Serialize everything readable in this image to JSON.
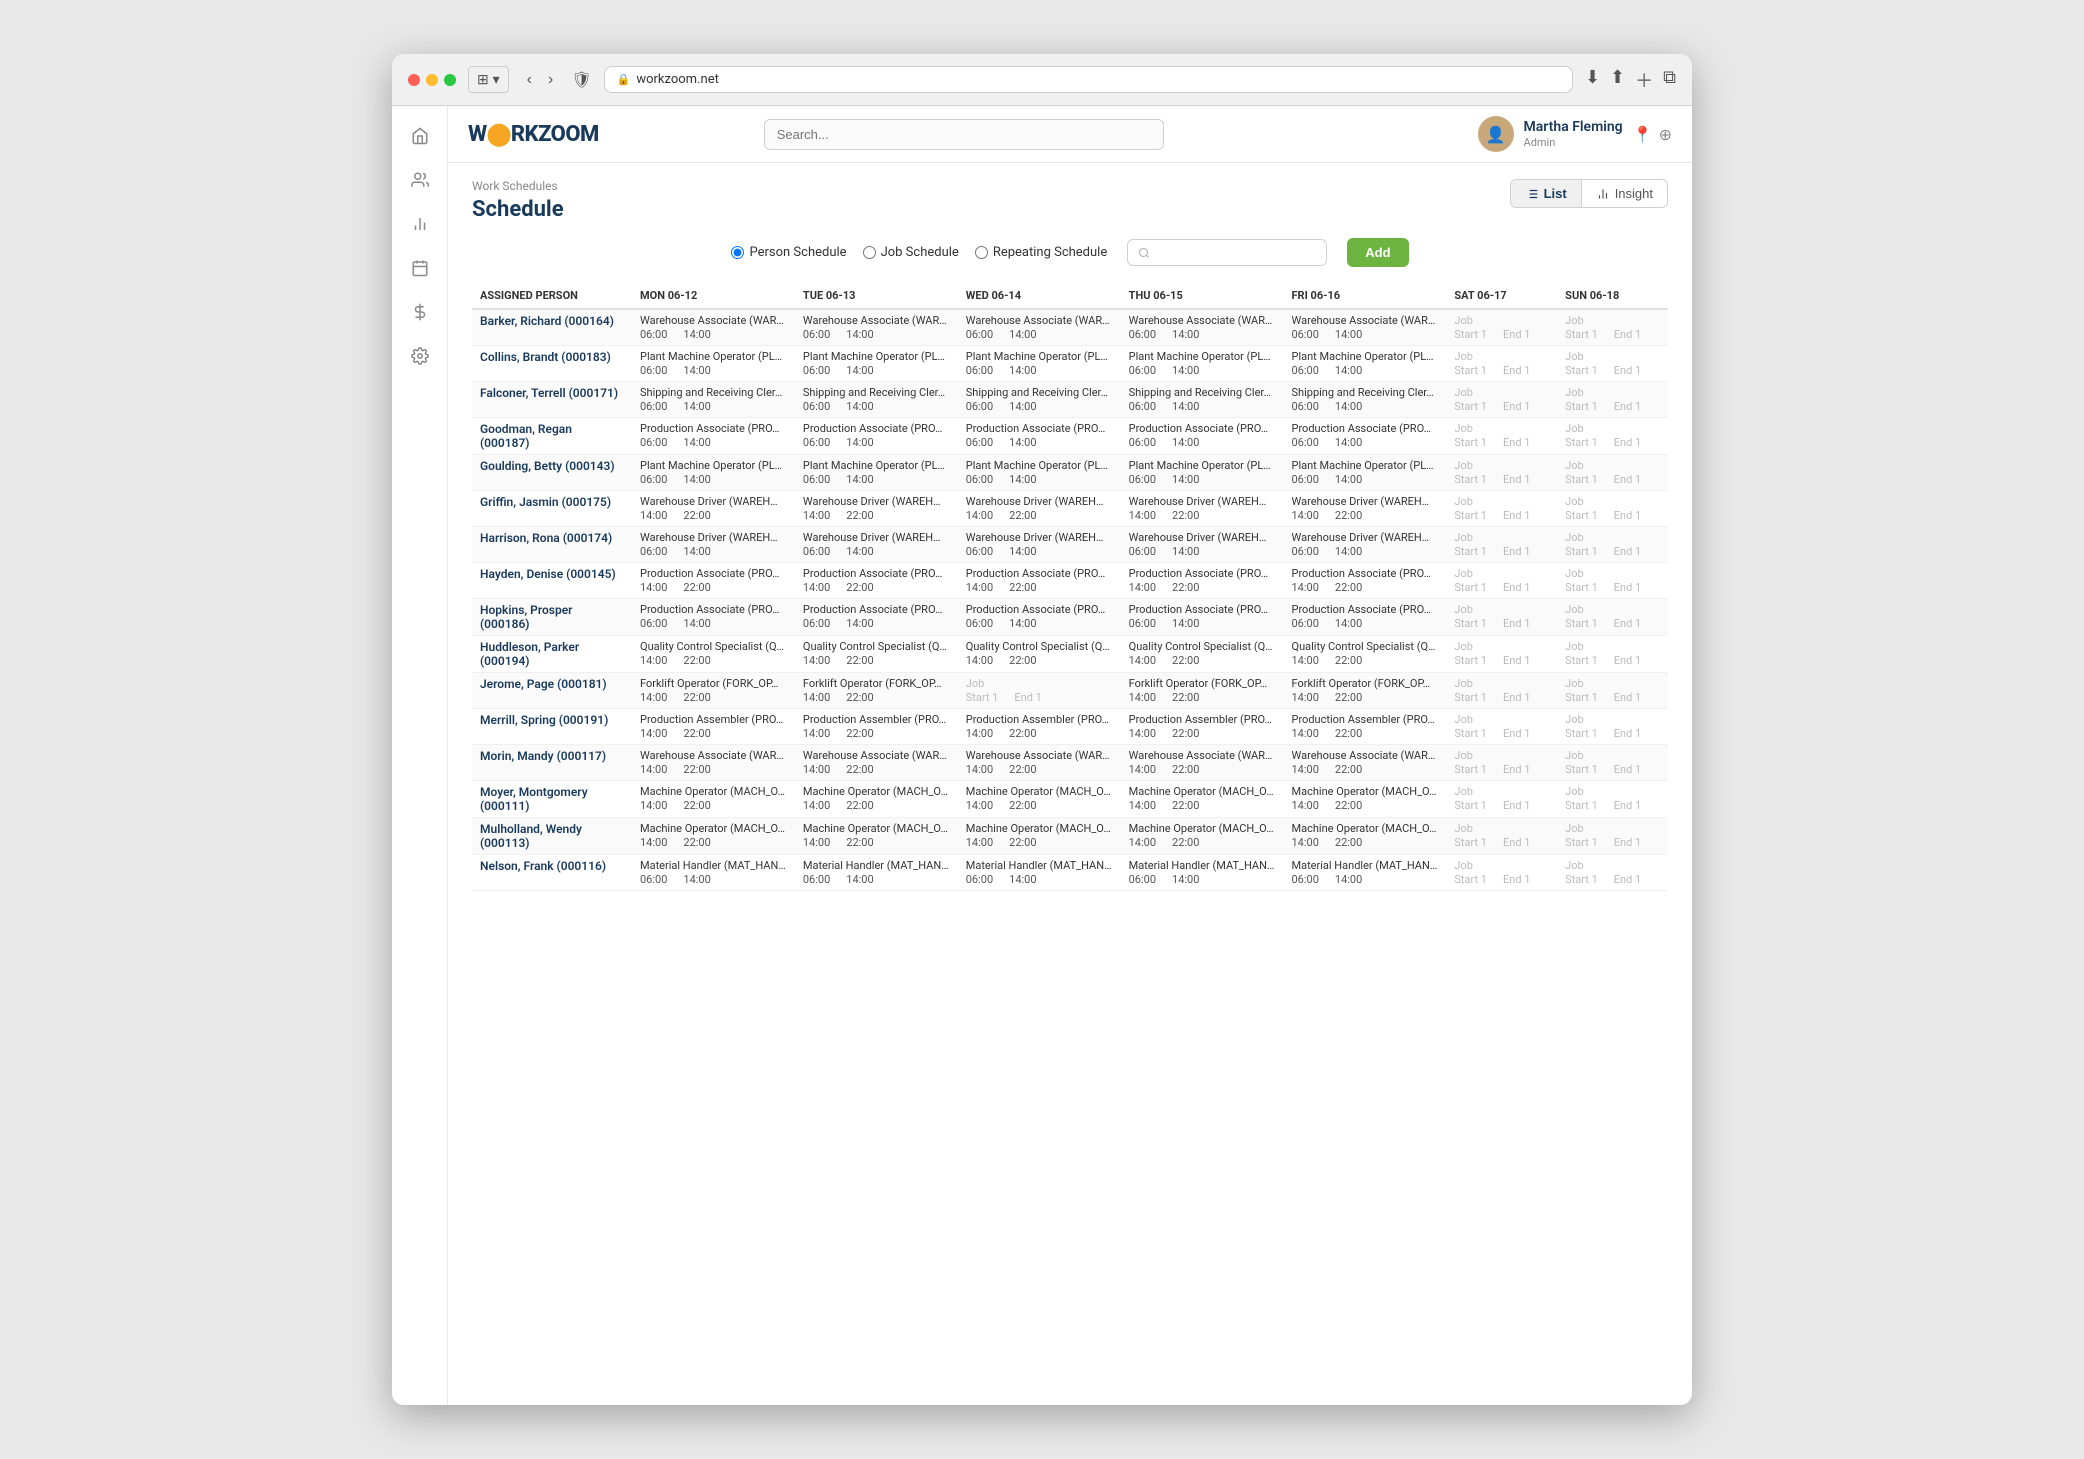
{
  "browser": {
    "url": "workzoom.net"
  },
  "header": {
    "logo": "WORKZOOM",
    "search_placeholder": "Search...",
    "user": {
      "name": "Martha Fleming",
      "role": "Admin"
    }
  },
  "breadcrumb": "Work Schedules",
  "page_title": "Schedule",
  "view_toggle": {
    "list_label": "List",
    "insight_label": "Insight"
  },
  "filters": {
    "person_schedule": "Person Schedule",
    "job_schedule": "Job Schedule",
    "repeating_schedule": "Repeating Schedule",
    "search_placeholder": "",
    "add_label": "Add"
  },
  "columns": [
    "ASSIGNED PERSON",
    "MON 06-12",
    "TUE 06-13",
    "WED 06-14",
    "THU 06-15",
    "FRI 06-16",
    "SAT 06-17",
    "SUN 06-18"
  ],
  "rows": [
    {
      "person": "Barker, Richard (000164)",
      "days": [
        {
          "job": "Warehouse Associate (WAR…",
          "start": "06:00",
          "end": "14:00"
        },
        {
          "job": "Warehouse Associate (WAR…",
          "start": "06:00",
          "end": "14:00"
        },
        {
          "job": "Warehouse Associate (WAR…",
          "start": "06:00",
          "end": "14:00"
        },
        {
          "job": "Warehouse Associate (WAR…",
          "start": "06:00",
          "end": "14:00"
        },
        {
          "job": "Warehouse Associate (WAR…",
          "start": "06:00",
          "end": "14:00"
        }
      ],
      "sat": {
        "job": "Job",
        "start": "Start 1",
        "end": "End 1"
      },
      "sun": {
        "job": "Job",
        "start": "Start 1",
        "end": "End 1"
      }
    },
    {
      "person": "Collins, Brandt (000183)",
      "days": [
        {
          "job": "Plant Machine Operator (PL…",
          "start": "06:00",
          "end": "14:00"
        },
        {
          "job": "Plant Machine Operator (PL…",
          "start": "06:00",
          "end": "14:00"
        },
        {
          "job": "Plant Machine Operator (PL…",
          "start": "06:00",
          "end": "14:00"
        },
        {
          "job": "Plant Machine Operator (PL…",
          "start": "06:00",
          "end": "14:00"
        },
        {
          "job": "Plant Machine Operator (PL…",
          "start": "06:00",
          "end": "14:00"
        }
      ],
      "sat": {
        "job": "Job",
        "start": "Start 1",
        "end": "End 1"
      },
      "sun": {
        "job": "Job",
        "start": "Start 1",
        "end": "End 1"
      }
    },
    {
      "person": "Falconer, Terrell (000171)",
      "days": [
        {
          "job": "Shipping and Receiving Cler…",
          "start": "06:00",
          "end": "14:00"
        },
        {
          "job": "Shipping and Receiving Cler…",
          "start": "06:00",
          "end": "14:00"
        },
        {
          "job": "Shipping and Receiving Cler…",
          "start": "06:00",
          "end": "14:00"
        },
        {
          "job": "Shipping and Receiving Cler…",
          "start": "06:00",
          "end": "14:00"
        },
        {
          "job": "Shipping and Receiving Cler…",
          "start": "06:00",
          "end": "14:00"
        }
      ],
      "sat": {
        "job": "Job",
        "start": "Start 1",
        "end": "End 1"
      },
      "sun": {
        "job": "Job",
        "start": "Start 1",
        "end": "End 1"
      }
    },
    {
      "person": "Goodman, Regan (000187)",
      "days": [
        {
          "job": "Production Associate (PRO…",
          "start": "06:00",
          "end": "14:00"
        },
        {
          "job": "Production Associate (PRO…",
          "start": "06:00",
          "end": "14:00"
        },
        {
          "job": "Production Associate (PRO…",
          "start": "06:00",
          "end": "14:00"
        },
        {
          "job": "Production Associate (PRO…",
          "start": "06:00",
          "end": "14:00"
        },
        {
          "job": "Production Associate (PRO…",
          "start": "06:00",
          "end": "14:00"
        }
      ],
      "sat": {
        "job": "Job",
        "start": "Start 1",
        "end": "End 1"
      },
      "sun": {
        "job": "Job",
        "start": "Start 1",
        "end": "End 1"
      }
    },
    {
      "person": "Goulding, Betty (000143)",
      "days": [
        {
          "job": "Plant Machine Operator (PL…",
          "start": "06:00",
          "end": "14:00"
        },
        {
          "job": "Plant Machine Operator (PL…",
          "start": "06:00",
          "end": "14:00"
        },
        {
          "job": "Plant Machine Operator (PL…",
          "start": "06:00",
          "end": "14:00"
        },
        {
          "job": "Plant Machine Operator (PL…",
          "start": "06:00",
          "end": "14:00"
        },
        {
          "job": "Plant Machine Operator (PL…",
          "start": "06:00",
          "end": "14:00"
        }
      ],
      "sat": {
        "job": "Job",
        "start": "Start 1",
        "end": "End 1"
      },
      "sun": {
        "job": "Job",
        "start": "Start 1",
        "end": "End 1"
      }
    },
    {
      "person": "Griffin, Jasmin (000175)",
      "days": [
        {
          "job": "Warehouse Driver (WAREH…",
          "start": "14:00",
          "end": "22:00"
        },
        {
          "job": "Warehouse Driver (WAREH…",
          "start": "14:00",
          "end": "22:00"
        },
        {
          "job": "Warehouse Driver (WAREH…",
          "start": "14:00",
          "end": "22:00"
        },
        {
          "job": "Warehouse Driver (WAREH…",
          "start": "14:00",
          "end": "22:00"
        },
        {
          "job": "Warehouse Driver (WAREH…",
          "start": "14:00",
          "end": "22:00"
        }
      ],
      "sat": {
        "job": "Job",
        "start": "Start 1",
        "end": "End 1"
      },
      "sun": {
        "job": "Job",
        "start": "Start 1",
        "end": "End 1"
      }
    },
    {
      "person": "Harrison, Rona (000174)",
      "days": [
        {
          "job": "Warehouse Driver (WAREH…",
          "start": "06:00",
          "end": "14:00"
        },
        {
          "job": "Warehouse Driver (WAREH…",
          "start": "06:00",
          "end": "14:00"
        },
        {
          "job": "Warehouse Driver (WAREH…",
          "start": "06:00",
          "end": "14:00"
        },
        {
          "job": "Warehouse Driver (WAREH…",
          "start": "06:00",
          "end": "14:00"
        },
        {
          "job": "Warehouse Driver (WAREH…",
          "start": "06:00",
          "end": "14:00"
        }
      ],
      "sat": {
        "job": "Job",
        "start": "Start 1",
        "end": "End 1"
      },
      "sun": {
        "job": "Job",
        "start": "Start 1",
        "end": "End 1"
      }
    },
    {
      "person": "Hayden, Denise (000145)",
      "days": [
        {
          "job": "Production Associate (PRO…",
          "start": "14:00",
          "end": "22:00"
        },
        {
          "job": "Production Associate (PRO…",
          "start": "14:00",
          "end": "22:00"
        },
        {
          "job": "Production Associate (PRO…",
          "start": "14:00",
          "end": "22:00"
        },
        {
          "job": "Production Associate (PRO…",
          "start": "14:00",
          "end": "22:00"
        },
        {
          "job": "Production Associate (PRO…",
          "start": "14:00",
          "end": "22:00"
        }
      ],
      "sat": {
        "job": "Job",
        "start": "Start 1",
        "end": "End 1"
      },
      "sun": {
        "job": "Job",
        "start": "Start 1",
        "end": "End 1"
      }
    },
    {
      "person": "Hopkins, Prosper (000186)",
      "days": [
        {
          "job": "Production Associate (PRO…",
          "start": "06:00",
          "end": "14:00"
        },
        {
          "job": "Production Associate (PRO…",
          "start": "06:00",
          "end": "14:00"
        },
        {
          "job": "Production Associate (PRO…",
          "start": "06:00",
          "end": "14:00"
        },
        {
          "job": "Production Associate (PRO…",
          "start": "06:00",
          "end": "14:00"
        },
        {
          "job": "Production Associate (PRO…",
          "start": "06:00",
          "end": "14:00"
        }
      ],
      "sat": {
        "job": "Job",
        "start": "Start 1",
        "end": "End 1"
      },
      "sun": {
        "job": "Job",
        "start": "Start 1",
        "end": "End 1"
      }
    },
    {
      "person": "Huddleson, Parker (000194)",
      "days": [
        {
          "job": "Quality Control Specialist (Q…",
          "start": "14:00",
          "end": "22:00"
        },
        {
          "job": "Quality Control Specialist (Q…",
          "start": "14:00",
          "end": "22:00"
        },
        {
          "job": "Quality Control Specialist (Q…",
          "start": "14:00",
          "end": "22:00"
        },
        {
          "job": "Quality Control Specialist (Q…",
          "start": "14:00",
          "end": "22:00"
        },
        {
          "job": "Quality Control Specialist (Q…",
          "start": "14:00",
          "end": "22:00"
        }
      ],
      "sat": {
        "job": "Job",
        "start": "Start 1",
        "end": "End 1"
      },
      "sun": {
        "job": "Job",
        "start": "Start 1",
        "end": "End 1"
      }
    },
    {
      "person": "Jerome, Page (000181)",
      "days": [
        {
          "job": "Forklift Operator (FORK_OP…",
          "start": "14:00",
          "end": "22:00"
        },
        {
          "job": "Forklift Operator (FORK_OP…",
          "start": "14:00",
          "end": "22:00"
        },
        {
          "job": "",
          "start": "Job",
          "end": ""
        },
        {
          "job": "Forklift Operator (FORK_OP…",
          "start": "14:00",
          "end": "22:00"
        },
        {
          "job": "Forklift Operator (FORK_OP…",
          "start": "14:00",
          "end": "22:00"
        }
      ],
      "sat": {
        "job": "Job",
        "start": "Start 1",
        "end": "End 1"
      },
      "sun": {
        "job": "Job",
        "start": "Start 1",
        "end": "End 1"
      }
    },
    {
      "person": "Merrill, Spring (000191)",
      "days": [
        {
          "job": "Production Assembler (PRO…",
          "start": "14:00",
          "end": "22:00"
        },
        {
          "job": "Production Assembler (PRO…",
          "start": "14:00",
          "end": "22:00"
        },
        {
          "job": "Production Assembler (PRO…",
          "start": "14:00",
          "end": "22:00"
        },
        {
          "job": "Production Assembler (PRO…",
          "start": "14:00",
          "end": "22:00"
        },
        {
          "job": "Production Assembler (PRO…",
          "start": "14:00",
          "end": "22:00"
        }
      ],
      "sat": {
        "job": "Job",
        "start": "Start 1",
        "end": "End 1"
      },
      "sun": {
        "job": "Job",
        "start": "Start 1",
        "end": "End 1"
      }
    },
    {
      "person": "Morin, Mandy (000117)",
      "days": [
        {
          "job": "Warehouse Associate (WAR…",
          "start": "14:00",
          "end": "22:00"
        },
        {
          "job": "Warehouse Associate (WAR…",
          "start": "14:00",
          "end": "22:00"
        },
        {
          "job": "Warehouse Associate (WAR…",
          "start": "14:00",
          "end": "22:00"
        },
        {
          "job": "Warehouse Associate (WAR…",
          "start": "14:00",
          "end": "22:00"
        },
        {
          "job": "Warehouse Associate (WAR…",
          "start": "14:00",
          "end": "22:00"
        }
      ],
      "sat": {
        "job": "Job",
        "start": "Start 1",
        "end": "End 1"
      },
      "sun": {
        "job": "Job",
        "start": "Start 1",
        "end": "End 1"
      }
    },
    {
      "person": "Moyer, Montgomery (000111)",
      "days": [
        {
          "job": "Machine Operator (MACH_O…",
          "start": "14:00",
          "end": "22:00"
        },
        {
          "job": "Machine Operator (MACH_O…",
          "start": "14:00",
          "end": "22:00"
        },
        {
          "job": "Machine Operator (MACH_O…",
          "start": "14:00",
          "end": "22:00"
        },
        {
          "job": "Machine Operator (MACH_O…",
          "start": "14:00",
          "end": "22:00"
        },
        {
          "job": "Machine Operator (MACH_O…",
          "start": "14:00",
          "end": "22:00"
        }
      ],
      "sat": {
        "job": "Job",
        "start": "Start 1",
        "end": "End 1"
      },
      "sun": {
        "job": "Job",
        "start": "Start 1",
        "end": "End 1"
      }
    },
    {
      "person": "Mulholland, Wendy (000113)",
      "days": [
        {
          "job": "Machine Operator (MACH_O…",
          "start": "14:00",
          "end": "22:00"
        },
        {
          "job": "Machine Operator (MACH_O…",
          "start": "14:00",
          "end": "22:00"
        },
        {
          "job": "Machine Operator (MACH_O…",
          "start": "14:00",
          "end": "22:00"
        },
        {
          "job": "Machine Operator (MACH_O…",
          "start": "14:00",
          "end": "22:00"
        },
        {
          "job": "Machine Operator (MACH_O…",
          "start": "14:00",
          "end": "22:00"
        }
      ],
      "sat": {
        "job": "Job",
        "start": "Start 1",
        "end": "End 1"
      },
      "sun": {
        "job": "Job",
        "start": "Start 1",
        "end": "End 1"
      }
    },
    {
      "person": "Nelson, Frank (000116)",
      "days": [
        {
          "job": "Material Handler (MAT_HAN…",
          "start": "06:00",
          "end": "14:00"
        },
        {
          "job": "Material Handler (MAT_HAN…",
          "start": "06:00",
          "end": "14:00"
        },
        {
          "job": "Material Handler (MAT_HAN…",
          "start": "06:00",
          "end": "14:00"
        },
        {
          "job": "Material Handler (MAT_HAN…",
          "start": "06:00",
          "end": "14:00"
        },
        {
          "job": "Material Handler (MAT_HAN…",
          "start": "06:00",
          "end": "14:00"
        }
      ],
      "sat": {
        "job": "Job",
        "start": "Start 1",
        "end": "End 1"
      },
      "sun": {
        "job": "Job",
        "start": "Start 1",
        "end": "End 1"
      }
    }
  ],
  "sidebar_icons": [
    "home",
    "people",
    "chart",
    "calendar",
    "dollar",
    "gear"
  ]
}
